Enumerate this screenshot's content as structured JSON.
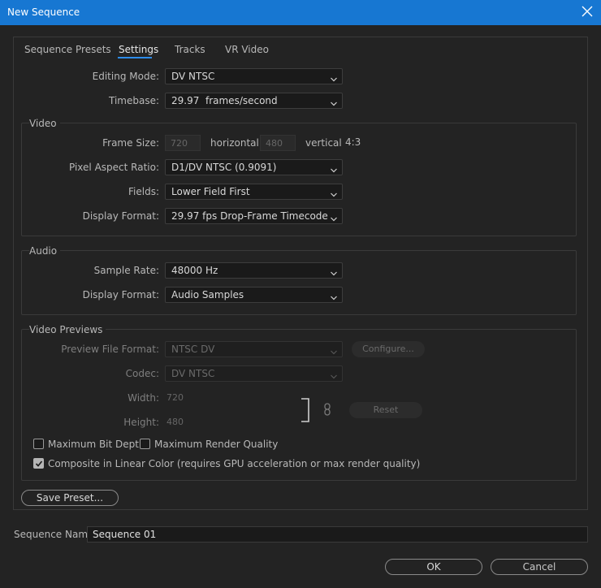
{
  "window": {
    "title": "New Sequence"
  },
  "tabs": [
    {
      "label": "Sequence Presets",
      "active": false
    },
    {
      "label": "Settings",
      "active": true
    },
    {
      "label": "Tracks",
      "active": false
    },
    {
      "label": "VR Video",
      "active": false
    }
  ],
  "general": {
    "editing_mode_label": "Editing Mode:",
    "editing_mode_value": "DV NTSC",
    "timebase_label": "Timebase:",
    "timebase_value": "29.97  frames/second"
  },
  "video": {
    "group_label": "Video",
    "frame_size_label": "Frame Size:",
    "frame_width": "720",
    "horizontal_label": "horizontal",
    "frame_height": "480",
    "vertical_label": "vertical",
    "aspect": "4:3",
    "pixel_aspect_label": "Pixel Aspect Ratio:",
    "pixel_aspect_value": "D1/DV NTSC (0.9091)",
    "fields_label": "Fields:",
    "fields_value": "Lower Field First",
    "display_format_label": "Display Format:",
    "display_format_value": "29.97 fps Drop-Frame Timecode"
  },
  "audio": {
    "group_label": "Audio",
    "sample_rate_label": "Sample Rate:",
    "sample_rate_value": "48000 Hz",
    "display_format_label": "Display Format:",
    "display_format_value": "Audio Samples"
  },
  "previews": {
    "group_label": "Video Previews",
    "file_format_label": "Preview File Format:",
    "file_format_value": "NTSC DV",
    "configure_label": "Configure...",
    "codec_label": "Codec:",
    "codec_value": "DV NTSC",
    "width_label": "Width:",
    "width_value": "720",
    "height_label": "Height:",
    "height_value": "480",
    "reset_label": "Reset"
  },
  "options": {
    "max_bit_depth_label": "Maximum Bit Depth",
    "max_bit_depth_checked": false,
    "max_render_quality_label": "Maximum Render Quality",
    "max_render_quality_checked": false,
    "linear_color_label": "Composite in Linear Color (requires GPU acceleration or max render quality)",
    "linear_color_checked": true
  },
  "save_preset_label": "Save Preset...",
  "sequence_name": {
    "label": "Sequence Name:",
    "value": "Sequence 01"
  },
  "ok_label": "OK",
  "cancel_label": "Cancel",
  "colors": {
    "titlebar": "#1777d2",
    "tab_underline": "#2d8ceb",
    "background": "#232323"
  }
}
